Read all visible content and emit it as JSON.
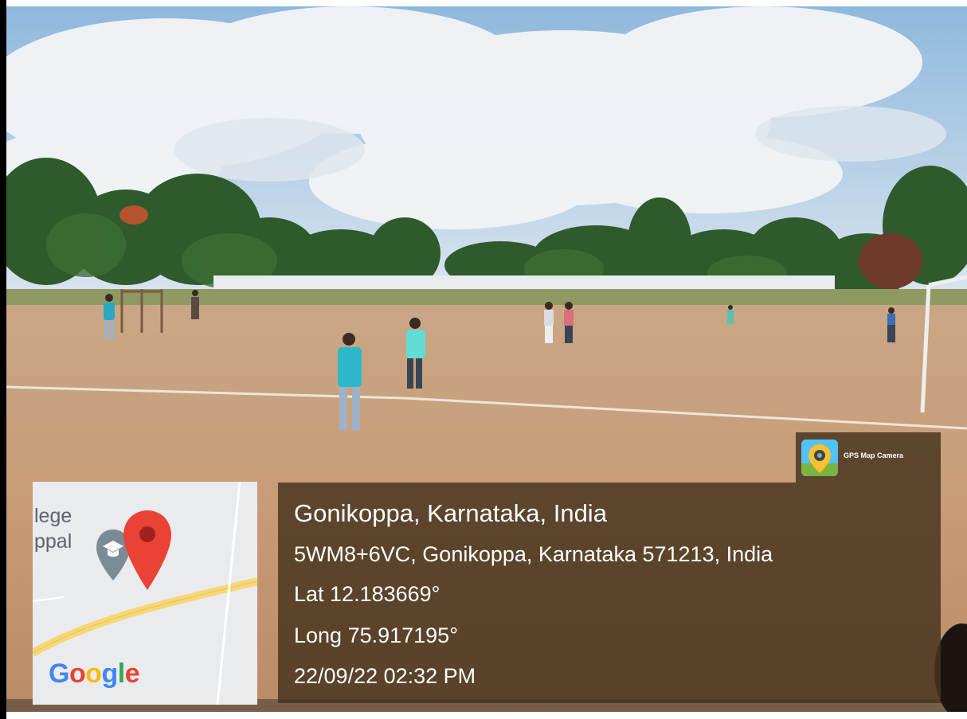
{
  "app": {
    "name": "GPS Map Camera",
    "icon": "gps-map-camera-icon"
  },
  "location": {
    "title": "Gonikoppa, Karnataka, India",
    "address": "5WM8+6VC, Gonikoppa, Karnataka 571213, India",
    "latitude": "Lat 12.183669°",
    "longitude": "Long 75.917195°",
    "datetime": "22/09/22 02:32 PM"
  },
  "map": {
    "label_line1": "lege",
    "label_line2": "ppal",
    "brand": [
      "G",
      "o",
      "o",
      "g",
      "l",
      "e"
    ],
    "brand_colors": [
      "#4285F4",
      "#EA4335",
      "#FBBC05",
      "#4285F4",
      "#34A853",
      "#EA4335"
    ],
    "pin_color": "#EA4335",
    "road_color": "#f7d774",
    "place_icon": "graduation-cap-icon"
  },
  "colors": {
    "overlay": "#48341e",
    "sky": "#8fb8dd",
    "ground": "#c9a07c"
  }
}
